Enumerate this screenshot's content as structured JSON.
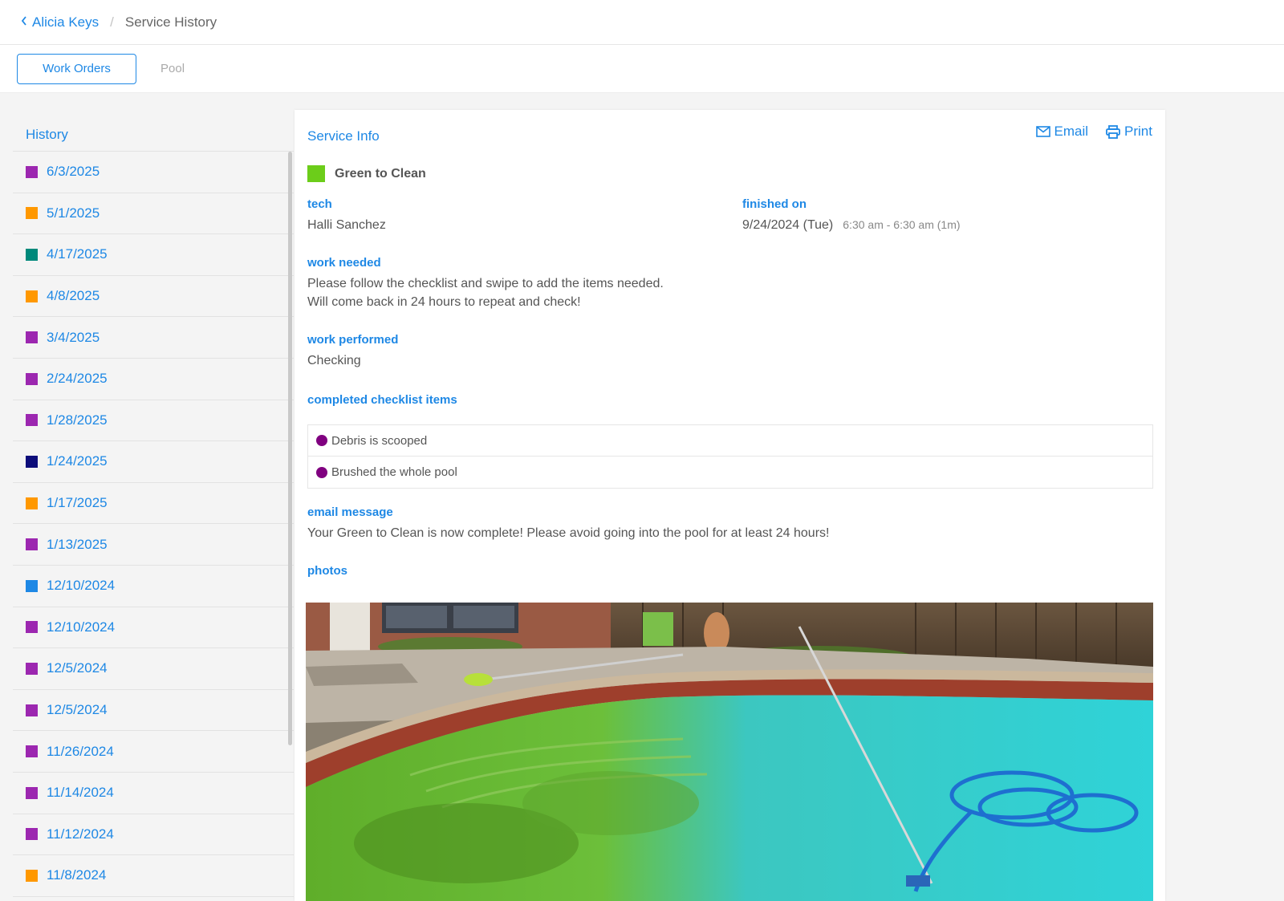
{
  "breadcrumb": {
    "back_label": "Alicia Keys",
    "separator": "/",
    "current": "Service History"
  },
  "tabs": [
    {
      "label": "Work Orders",
      "active": true
    },
    {
      "label": "Pool",
      "active": false
    }
  ],
  "sidebar": {
    "title": "History",
    "items": [
      {
        "date": "6/3/2025",
        "color": "#9c27b0"
      },
      {
        "date": "5/1/2025",
        "color": "#ff9800"
      },
      {
        "date": "4/17/2025",
        "color": "#00897b"
      },
      {
        "date": "4/8/2025",
        "color": "#ff9800"
      },
      {
        "date": "3/4/2025",
        "color": "#9c27b0"
      },
      {
        "date": "2/24/2025",
        "color": "#9c27b0"
      },
      {
        "date": "1/28/2025",
        "color": "#9c27b0"
      },
      {
        "date": "1/24/2025",
        "color": "#0d0d7a"
      },
      {
        "date": "1/17/2025",
        "color": "#ff9800"
      },
      {
        "date": "1/13/2025",
        "color": "#9c27b0"
      },
      {
        "date": "12/10/2024",
        "color": "#1e88e5"
      },
      {
        "date": "12/10/2024",
        "color": "#9c27b0"
      },
      {
        "date": "12/5/2024",
        "color": "#9c27b0"
      },
      {
        "date": "12/5/2024",
        "color": "#9c27b0"
      },
      {
        "date": "11/26/2024",
        "color": "#9c27b0"
      },
      {
        "date": "11/14/2024",
        "color": "#9c27b0"
      },
      {
        "date": "11/12/2024",
        "color": "#9c27b0"
      },
      {
        "date": "11/8/2024",
        "color": "#ff9800"
      }
    ]
  },
  "service": {
    "title": "Service Info",
    "email_label": "Email",
    "print_label": "Print",
    "type_label": "Green to Clean",
    "type_color": "#6ccd1a",
    "tech_label": "tech",
    "tech_value": "Halli Sanchez",
    "finished_label": "finished on",
    "finished_date": "9/24/2024 (Tue)",
    "finished_time": "6:30 am - 6:30 am (1m)",
    "work_needed_label": "work needed",
    "work_needed_line1": "Please follow the checklist and swipe to add the items needed.",
    "work_needed_line2": "Will come back in 24 hours to repeat and check!",
    "work_performed_label": "work performed",
    "work_performed_value": "Checking",
    "checklist_label": "completed checklist items",
    "checklist": [
      {
        "text": "Debris is scooped",
        "color": "#800080"
      },
      {
        "text": "Brushed the whole pool",
        "color": "#800080"
      }
    ],
    "email_message_label": "email message",
    "email_message_value": "Your Green to Clean is now complete! Please avoid going into the pool for at least 24 hours!",
    "photos_label": "photos"
  },
  "accent_color": "#1e88e5"
}
